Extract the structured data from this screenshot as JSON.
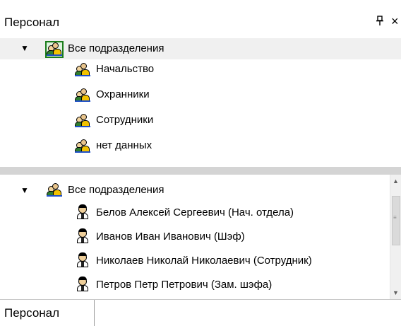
{
  "panel": {
    "title": "Персонал",
    "pin_glyph": "ᵾ",
    "close_glyph": "×"
  },
  "top_tree": {
    "root": {
      "label": "Все подразделения",
      "icon": "group-icon",
      "expanded": true,
      "selected": true
    },
    "children": [
      {
        "label": "Начальство",
        "icon": "group-icon"
      },
      {
        "label": "Охранники",
        "icon": "group-icon"
      },
      {
        "label": "Сотрудники",
        "icon": "group-icon"
      },
      {
        "label": "нет данных",
        "icon": "group-icon"
      }
    ]
  },
  "bottom_tree": {
    "root": {
      "label": "Все подразделения",
      "icon": "group-icon",
      "expanded": true
    },
    "people": [
      {
        "label": "Белов Алексей Сергеевич (Нач. отдела)",
        "icon": "person-icon"
      },
      {
        "label": "Иванов Иван Иванович (Шэф)",
        "icon": "person-icon"
      },
      {
        "label": "Николаев Николай Николаевич (Сотрудник)",
        "icon": "person-icon"
      },
      {
        "label": "Петров Петр Петрович (Зам. шэфа)",
        "icon": "person-icon"
      }
    ]
  },
  "footer": {
    "tab_label": "Персонал"
  },
  "glyphs": {
    "expanded": "▼",
    "scroll_up": "▲",
    "scroll_down": "▼"
  },
  "colors": {
    "selection_border": "#1b7d1b",
    "splitter": "#d4d4d4"
  }
}
